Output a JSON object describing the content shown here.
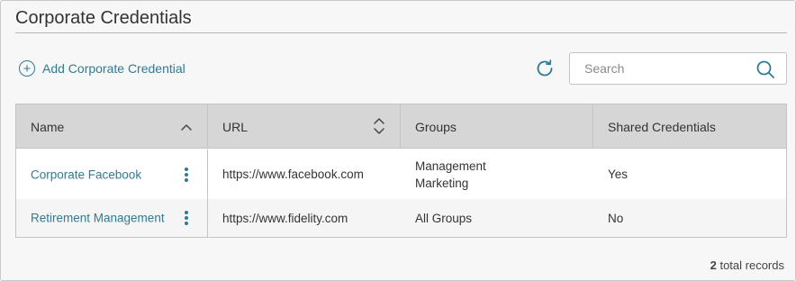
{
  "page": {
    "title": "Corporate Credentials"
  },
  "toolbar": {
    "add_label": "Add Corporate Credential",
    "plus_icon": "plus-circle-icon",
    "refresh_icon": "refresh-icon",
    "search_placeholder": "Search",
    "search_value": "",
    "search_icon": "search-icon"
  },
  "table": {
    "columns": [
      {
        "label": "Name",
        "sort": "ascending"
      },
      {
        "label": "URL",
        "sort": "sortable"
      },
      {
        "label": "Groups",
        "sort": "none"
      },
      {
        "label": "Shared Credentials",
        "sort": "none"
      }
    ],
    "rows": [
      {
        "name": "Corporate Facebook",
        "url": "https://www.facebook.com",
        "groups": [
          "Management",
          "Marketing"
        ],
        "shared": "Yes"
      },
      {
        "name": "Retirement Management",
        "url": "https://www.fidelity.com",
        "groups": [
          "All Groups"
        ],
        "shared": "No"
      }
    ]
  },
  "footer": {
    "count": "2",
    "label": "total records"
  },
  "colors": {
    "accent": "#2f7b94",
    "header_bg": "#d6d6d6",
    "page_bg": "#f7f7f7"
  }
}
